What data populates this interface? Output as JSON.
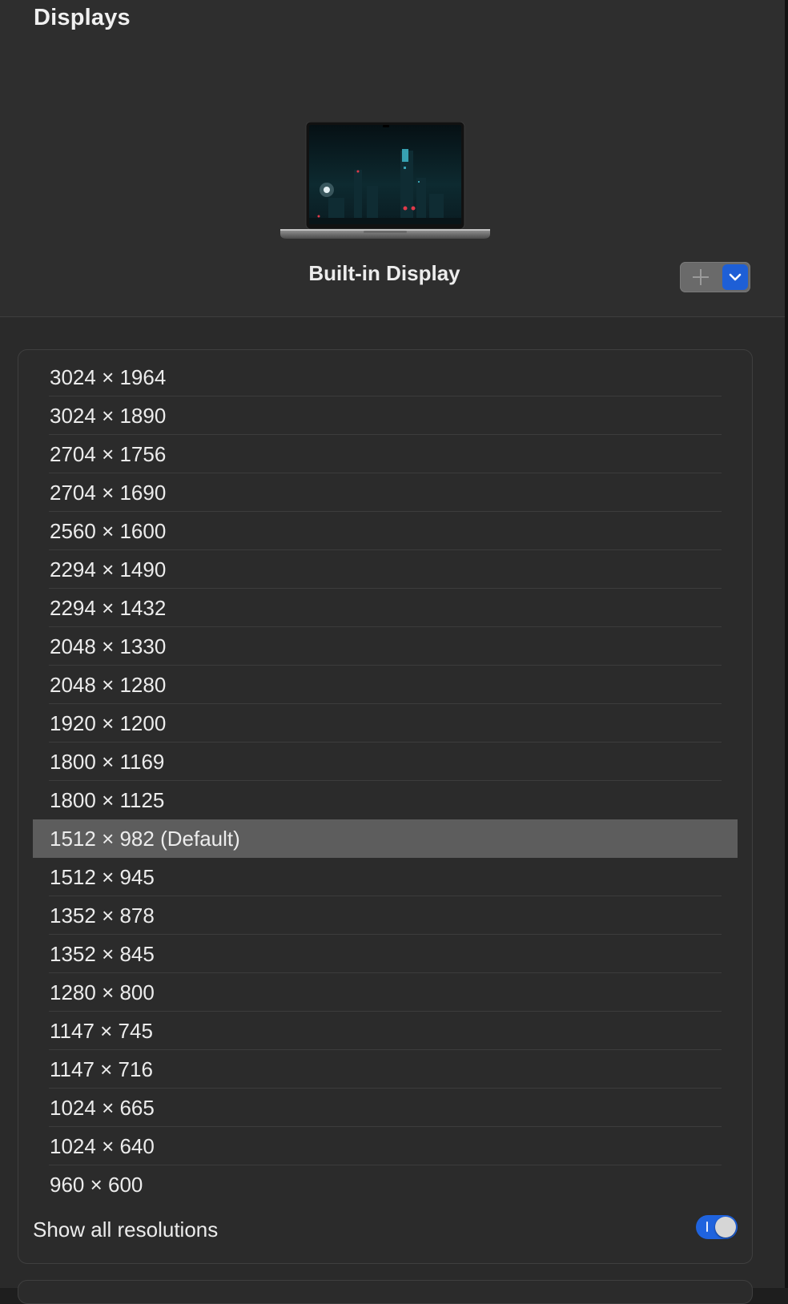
{
  "window": {
    "title": "Displays"
  },
  "display": {
    "name": "Built-in Display",
    "icon": "laptop-icon",
    "add_icon": "plus-icon",
    "menu_icon": "chevron-down-icon"
  },
  "resolutions": {
    "items": [
      {
        "label": "3024 × 1964",
        "selected": false
      },
      {
        "label": "3024 × 1890",
        "selected": false
      },
      {
        "label": "2704 × 1756",
        "selected": false
      },
      {
        "label": "2704 × 1690",
        "selected": false
      },
      {
        "label": "2560 × 1600",
        "selected": false
      },
      {
        "label": "2294 × 1490",
        "selected": false
      },
      {
        "label": "2294 × 1432",
        "selected": false
      },
      {
        "label": "2048 × 1330",
        "selected": false
      },
      {
        "label": "2048 × 1280",
        "selected": false
      },
      {
        "label": "1920 × 1200",
        "selected": false
      },
      {
        "label": "1800 × 1169",
        "selected": false
      },
      {
        "label": "1800 × 1125",
        "selected": false
      },
      {
        "label": "1512 × 982 (Default)",
        "selected": true
      },
      {
        "label": "1512 × 945",
        "selected": false
      },
      {
        "label": "1352 × 878",
        "selected": false
      },
      {
        "label": "1352 × 845",
        "selected": false
      },
      {
        "label": "1280 × 800",
        "selected": false
      },
      {
        "label": "1147 × 745",
        "selected": false
      },
      {
        "label": "1147 × 716",
        "selected": false
      },
      {
        "label": "1024 × 665",
        "selected": false
      },
      {
        "label": "1024 × 640",
        "selected": false
      },
      {
        "label": "960 × 600",
        "selected": false
      }
    ],
    "show_all_label": "Show all resolutions",
    "show_all_enabled": true
  },
  "colors": {
    "accent": "#1f63de",
    "selection": "#5d5d5d",
    "background": "#2a2a2a"
  }
}
